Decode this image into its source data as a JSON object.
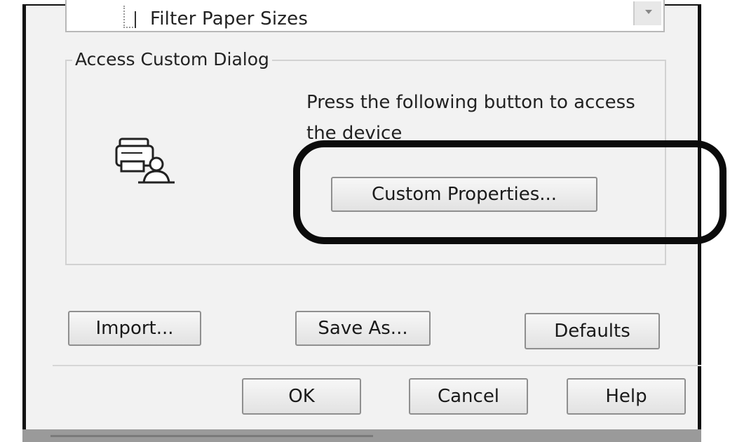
{
  "tree": {
    "item_label": "Filter Paper Sizes"
  },
  "custom_dialog": {
    "group_title": "Access Custom Dialog",
    "description": "Press the following button to access the device",
    "custom_properties_label": "Custom Properties...",
    "icon": "printer-user-icon"
  },
  "actions": {
    "import_label": "Import...",
    "save_as_label": "Save As...",
    "defaults_label": "Defaults"
  },
  "footer": {
    "ok_label": "OK",
    "cancel_label": "Cancel",
    "help_label": "Help"
  },
  "colors": {
    "dialog_bg": "#f2f2f2",
    "highlight": "#0b0b0b"
  }
}
